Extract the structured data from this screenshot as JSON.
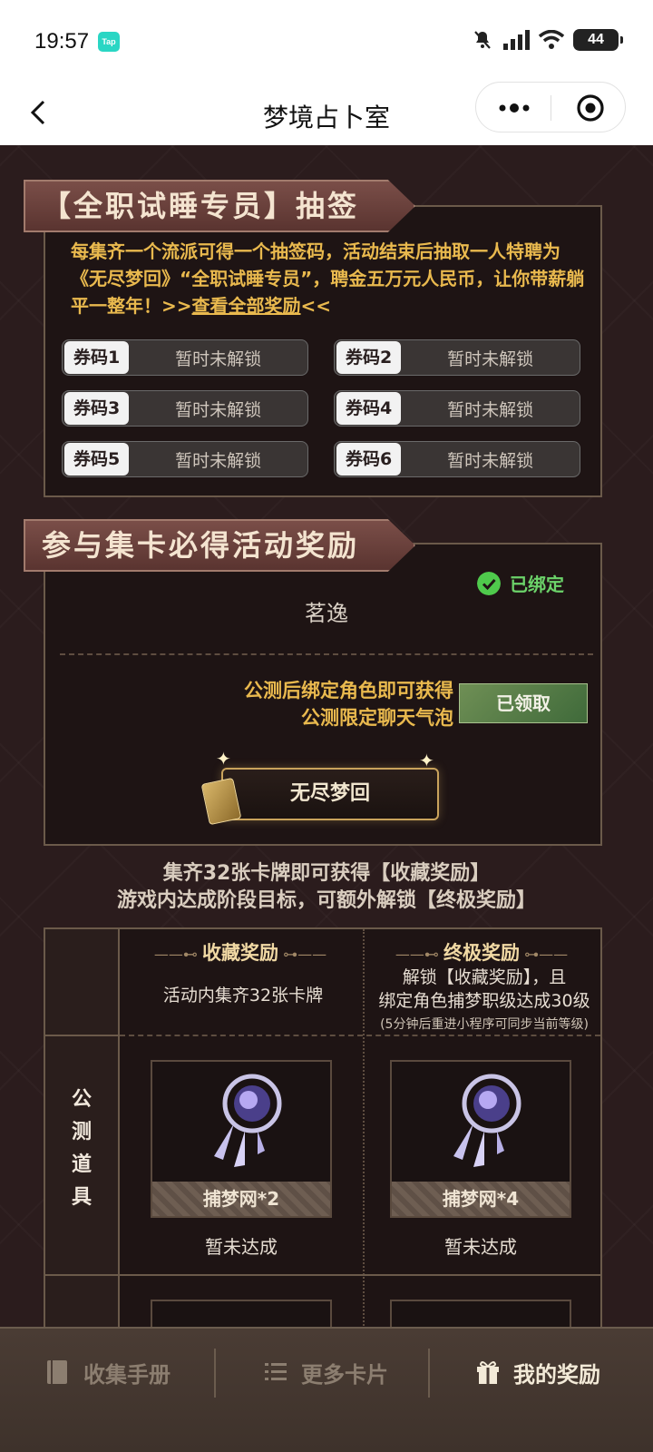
{
  "status_bar": {
    "time": "19:57",
    "app_badge": "Tap",
    "battery": "44"
  },
  "nav": {
    "title": "梦境占卜室"
  },
  "lottery": {
    "heading": "【全职试睡专员】抽签码",
    "description": "每集齐一个流派可得一个抽签码，活动结束后抽取一人特聘为《无尽梦回》“全职试睡专员”，聘金五万元人民币，让你带薪躺平一整年！>>",
    "link_text": "查看全部奖励",
    "link_suffix": "<<",
    "codes": [
      {
        "tag": "券码1",
        "status": "暂时未解锁"
      },
      {
        "tag": "券码2",
        "status": "暂时未解锁"
      },
      {
        "tag": "券码3",
        "status": "暂时未解锁"
      },
      {
        "tag": "券码4",
        "status": "暂时未解锁"
      },
      {
        "tag": "券码5",
        "status": "暂时未解锁"
      },
      {
        "tag": "券码6",
        "status": "暂时未解锁"
      }
    ]
  },
  "participation": {
    "heading": "参与集卡必得活动奖励",
    "bound_label": "已绑定",
    "username": "茗逸",
    "reward_line1": "公测后绑定角色即可获得",
    "reward_line2": "公测限定聊天气泡",
    "claimed_label": "已领取",
    "game_button": "无尽梦回"
  },
  "collect_hint": {
    "line1": "集齐32张卡牌即可获得【收藏奖励】",
    "line2": "游戏内达成阶段目标，可额外解锁【终极奖励】"
  },
  "rewards_table": {
    "col1_title": "收藏奖励",
    "col1_desc": "活动内集齐32张卡牌",
    "col2_title": "终极奖励",
    "col2_desc_line1": "解锁【收藏奖励】，且",
    "col2_desc_line2": "绑定角色捕梦职级达成30级",
    "col2_desc_note": "(5分钟后重进小程序可同步当前等级)",
    "row_label": "公测道具",
    "items": [
      {
        "name": "捕梦网*2",
        "status": "暂未达成"
      },
      {
        "name": "捕梦网*4",
        "status": "暂未达成"
      }
    ]
  },
  "tabbar": {
    "tabs": [
      {
        "label": "收集手册",
        "icon": "book-icon"
      },
      {
        "label": "更多卡片",
        "icon": "list-icon"
      },
      {
        "label": "我的奖励",
        "icon": "gift-icon"
      }
    ],
    "active_index": 2
  },
  "colors": {
    "gold_text": "#e9b94e",
    "bound_green": "#6cd36a",
    "panel_bg": "#1e1414"
  }
}
